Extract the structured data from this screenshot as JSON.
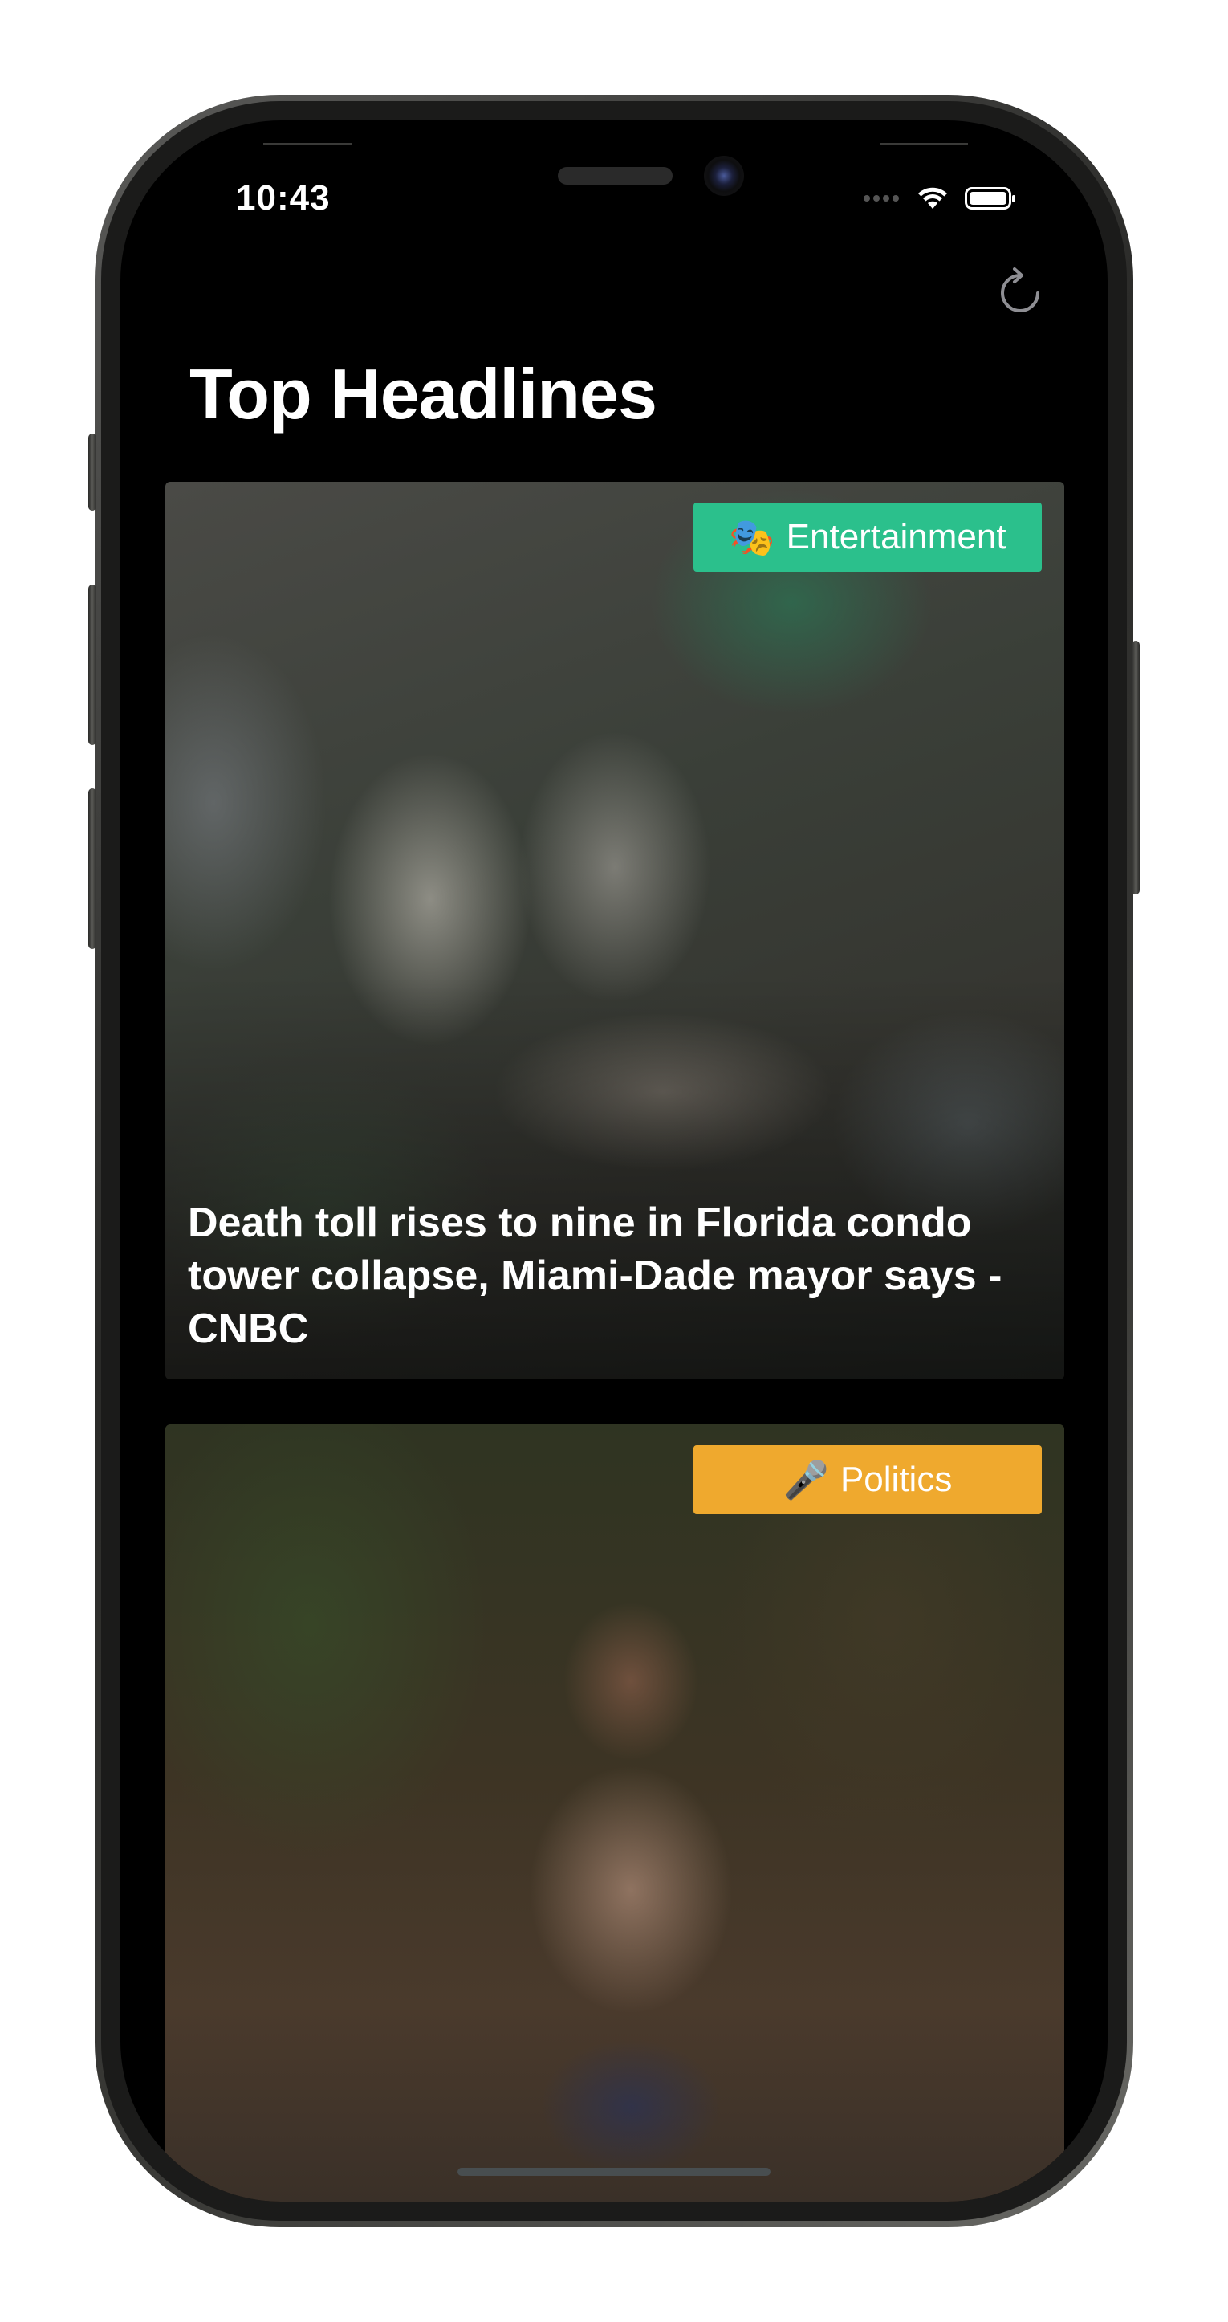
{
  "status_bar": {
    "time": "10:43"
  },
  "nav": {
    "title": "Top Headlines",
    "refresh_icon": "refresh-icon"
  },
  "articles": [
    {
      "category": "Entertainment",
      "category_emoji": "🎭",
      "category_color": "#2bc08c",
      "headline": "Death toll rises to nine in Florida condo tower collapse, Miami-Dade mayor says - CNBC"
    },
    {
      "category": "Politics",
      "category_emoji": "🎤",
      "category_color": "#efa92e",
      "headline": ""
    }
  ]
}
